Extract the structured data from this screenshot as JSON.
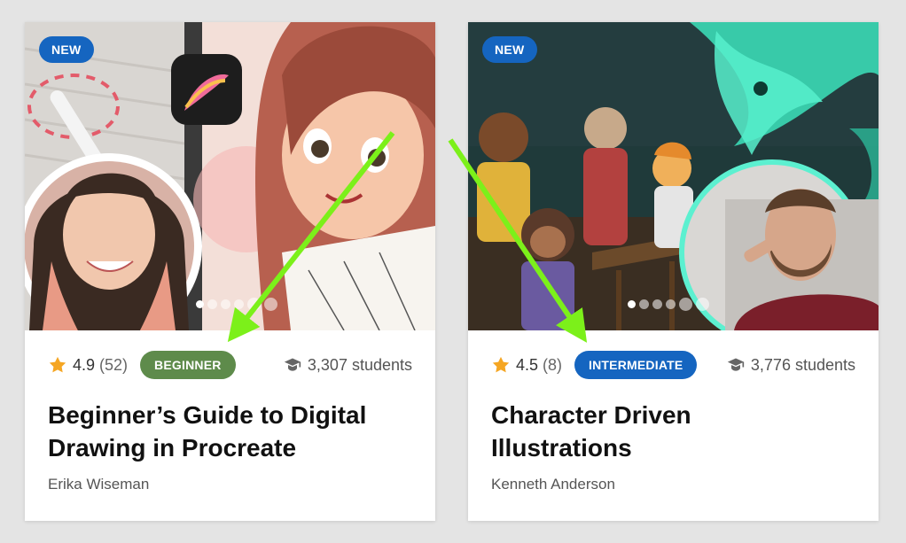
{
  "cards": [
    {
      "badge": "NEW",
      "rating": "4.9",
      "reviews": "(52)",
      "level": "BEGINNER",
      "students": "3,307 students",
      "title_line1": "Beginner’s Guide to Digital",
      "title_line2": "Drawing in Procreate",
      "author": "Erika Wiseman",
      "image_alt": "Procreate illustration of a girl with red hair and instructor photo"
    },
    {
      "badge": "NEW",
      "rating": "4.5",
      "reviews": "(8)",
      "level": "INTERMEDIATE",
      "students": "3,776 students",
      "title_line1": "Character Driven",
      "title_line2": "Illustrations",
      "author": "Kenneth Anderson",
      "image_alt": "Illustration of kids exploring a haunted house with ghosts and instructor photo"
    }
  ],
  "colors": {
    "new_badge": "#1565c0",
    "beginner": "#5e8b4b",
    "intermediate": "#1565c0",
    "star": "#f5a623",
    "annotation_arrow": "#7cf01a"
  },
  "icons": [
    "star-icon",
    "graduate-icon"
  ]
}
